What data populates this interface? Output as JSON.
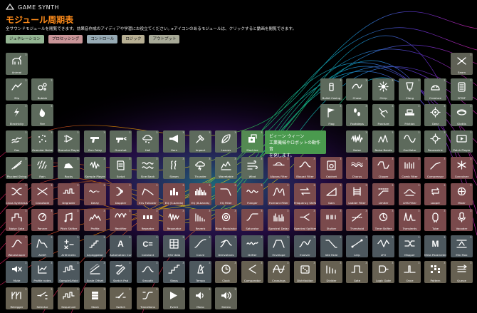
{
  "app": {
    "logo_text": "GAME SYNTH",
    "title": "モジュール周期表",
    "description": "全サウンドモジュールを閲覧できます。効果音作成のアイディアや学習にお役立てください。▸アイコンのあるモジュールは、クリックすると動画を閲覧できます。"
  },
  "filters": [
    {
      "label": "ジェネレーション",
      "color": "#94b593"
    },
    {
      "label": "プロセッシング",
      "color": "#c99598"
    },
    {
      "label": "コントロール",
      "color": "#97abb5"
    },
    {
      "label": "ロジック",
      "color": "#b8b094"
    },
    {
      "label": "アウトプット",
      "color": "#a8aa98"
    }
  ],
  "tooltip": {
    "line1": "ビィーン ウィーン",
    "line2": "工業機械やロボットの動作音",
    "line3": "を発します。"
  },
  "colors": {
    "generation": "#5d6a5c",
    "processing": "#7a4a4c",
    "control": "#4d585e",
    "logic": "#676152",
    "output": "#5f6155",
    "selected": "#548a52"
  },
  "modules": [
    {
      "label": "Animal",
      "cat": "gen",
      "icon": "animal"
    },
    {
      "label": "Seam",
      "cat": "out",
      "icon": "seam"
    },
    {
      "label": "Slip",
      "cat": "gen",
      "icon": "slip"
    },
    {
      "label": "Bubble",
      "cat": "gen",
      "icon": "bubble"
    },
    {
      "label": "Bullet Casing",
      "cat": "gen",
      "icon": "bullet"
    },
    {
      "label": "Chase",
      "cat": "gen",
      "icon": "chase"
    },
    {
      "label": "Chirp",
      "cat": "gen",
      "icon": "chirp"
    },
    {
      "label": "Clang",
      "cat": "gen",
      "icon": "clang"
    },
    {
      "label": "Creature",
      "cat": "gen",
      "icon": "creature"
    },
    {
      "label": "DTMF",
      "cat": "gen",
      "icon": "dtmf"
    },
    {
      "label": "Electricity",
      "cat": "gen",
      "icon": "electricity"
    },
    {
      "label": "Fire",
      "cat": "gen",
      "icon": "fire"
    },
    {
      "label": "Flag",
      "cat": "gen",
      "icon": "flag"
    },
    {
      "label": "Footsteps",
      "cat": "gen",
      "icon": "footsteps"
    },
    {
      "label": "Fracture",
      "cat": "gen",
      "icon": "fracture"
    },
    {
      "label": "Friction",
      "cat": "gen",
      "icon": "friction"
    },
    {
      "label": "Gear",
      "cat": "gen",
      "icon": "gear"
    },
    {
      "label": "Glottis",
      "cat": "gen",
      "icon": "glottis"
    },
    {
      "label": "Gas",
      "cat": "gen",
      "icon": "gas"
    },
    {
      "label": "Granular Noise",
      "cat": "gen",
      "icon": "granular"
    },
    {
      "label": "Granular Player",
      "cat": "gen",
      "icon": "gplayer"
    },
    {
      "label": "Gun Foley",
      "cat": "gen",
      "icon": "gunfoley"
    },
    {
      "label": "Gunshot",
      "cat": "gen",
      "icon": "gunshot"
    },
    {
      "label": "Hail",
      "cat": "gen",
      "icon": "hail"
    },
    {
      "label": "Horn",
      "cat": "gen",
      "icon": "horn"
    },
    {
      "label": "Impact",
      "cat": "gen",
      "icon": "impact"
    },
    {
      "label": "Leaves",
      "cat": "gen",
      "icon": "leaves"
    },
    {
      "label": "Machine",
      "cat": "sel",
      "icon": "machine"
    },
    {
      "label": "Noise",
      "cat": "gen",
      "icon": "noise"
    },
    {
      "label": "Noise Bands",
      "cat": "gen",
      "icon": "noisebands"
    },
    {
      "label": "Oscillator",
      "cat": "gen",
      "icon": "osc"
    },
    {
      "label": "Parametric",
      "cat": "gen",
      "icon": "parametric"
    },
    {
      "label": "Patch Player",
      "cat": "gen",
      "icon": "patchplayer"
    },
    {
      "label": "Plucked String",
      "cat": "gen",
      "icon": "plucked"
    },
    {
      "label": "Rain",
      "cat": "gen",
      "icon": "rain"
    },
    {
      "label": "Rocks",
      "cat": "gen",
      "icon": "rocks"
    },
    {
      "label": "Sample Player",
      "cat": "gen",
      "icon": "sampleplayer"
    },
    {
      "label": "Script",
      "cat": "gen",
      "icon": "script"
    },
    {
      "label": "Sine Bank",
      "cat": "gen",
      "icon": "sinebank"
    },
    {
      "label": "Steam",
      "cat": "gen",
      "icon": "steam"
    },
    {
      "label": "Thunder",
      "cat": "gen",
      "icon": "thunder"
    },
    {
      "label": "Wavetable",
      "cat": "gen",
      "icon": "wavetable"
    },
    {
      "label": "Wind",
      "cat": "gen",
      "icon": "wind"
    },
    {
      "label": "Allpass Filter",
      "cat": "proc",
      "icon": "allpass"
    },
    {
      "label": "Biquad Filter",
      "cat": "proc",
      "icon": "biquad"
    },
    {
      "label": "Cabinet",
      "cat": "proc",
      "icon": "cabinet"
    },
    {
      "label": "Chorus",
      "cat": "proc",
      "icon": "chorus"
    },
    {
      "label": "Clipper",
      "cat": "proc",
      "icon": "clipper"
    },
    {
      "label": "Comb Filter",
      "cat": "proc",
      "icon": "comb"
    },
    {
      "label": "Compressor",
      "cat": "proc",
      "icon": "compressor"
    },
    {
      "label": "Convolver",
      "cat": "proc",
      "icon": "convolver"
    },
    {
      "label": "Cross Synthesis",
      "cat": "proc",
      "icon": "cross"
    },
    {
      "label": "Crossfade",
      "cat": "proc",
      "icon": "crossfade"
    },
    {
      "label": "Degrader",
      "cat": "proc",
      "icon": "degrader"
    },
    {
      "label": "Delay",
      "cat": "proc",
      "icon": "delay"
    },
    {
      "label": "Doppler",
      "cat": "proc",
      "icon": "doppler"
    },
    {
      "label": "Env Follower",
      "cat": "proc",
      "icon": "envfollow"
    },
    {
      "label": "EQ (3-bands)",
      "cat": "proc",
      "icon": "eq3"
    },
    {
      "label": "EQ (8-bands)",
      "cat": "proc",
      "icon": "eq8"
    },
    {
      "label": "EQ Filter",
      "cat": "proc",
      "icon": "eqfilter"
    },
    {
      "label": "Flanger",
      "cat": "proc",
      "icon": "flanger"
    },
    {
      "label": "Formant Filter",
      "cat": "proc",
      "icon": "formant"
    },
    {
      "label": "Frequency Shifter",
      "cat": "proc",
      "icon": "freqshift"
    },
    {
      "label": "Gain",
      "cat": "proc",
      "icon": "gain"
    },
    {
      "label": "Ladder Filter",
      "cat": "proc",
      "icon": "ladder"
    },
    {
      "label": "Limiter",
      "cat": "proc",
      "icon": "limiter"
    },
    {
      "label": "LMS Filter",
      "cat": "proc",
      "icon": "lms"
    },
    {
      "label": "Looper",
      "cat": "proc",
      "icon": "looper"
    },
    {
      "label": "Mixer",
      "cat": "proc",
      "icon": "mixer"
    },
    {
      "label": "Noise Gate",
      "cat": "proc",
      "icon": "noisegate"
    },
    {
      "label": "Panner",
      "cat": "proc",
      "icon": "panner"
    },
    {
      "label": "Pitch Shifter",
      "cat": "proc",
      "icon": "pitch"
    },
    {
      "label": "Profile",
      "cat": "proc",
      "icon": "profile"
    },
    {
      "label": "Rectifier",
      "cat": "proc",
      "icon": "rectifier"
    },
    {
      "label": "Repeater",
      "cat": "proc",
      "icon": "repeater"
    },
    {
      "label": "Resonator",
      "cat": "proc",
      "icon": "resonator"
    },
    {
      "label": "Reverb",
      "cat": "proc",
      "icon": "reverb"
    },
    {
      "label": "Ring Modulator",
      "cat": "proc",
      "icon": "ring"
    },
    {
      "label": "Saturator",
      "cat": "proc",
      "icon": "saturator"
    },
    {
      "label": "Spectral Delay",
      "cat": "proc",
      "icon": "specdelay"
    },
    {
      "label": "Spectral Splitter",
      "cat": "proc",
      "icon": "specsplit"
    },
    {
      "label": "Stutter",
      "cat": "proc",
      "icon": "stutter"
    },
    {
      "label": "Threshold",
      "cat": "proc",
      "icon": "threshold"
    },
    {
      "label": "Time Shifter",
      "cat": "proc",
      "icon": "timeshift"
    },
    {
      "label": "Transients",
      "cat": "proc",
      "icon": "transients"
    },
    {
      "label": "Tube",
      "cat": "proc",
      "icon": "tube"
    },
    {
      "label": "Vocoder",
      "cat": "proc",
      "icon": "vocoder"
    },
    {
      "label": "Waveshaper",
      "cat": "proc",
      "icon": "waveshaper"
    },
    {
      "label": "ADSR",
      "cat": "ctrl",
      "icon": "adsr"
    },
    {
      "label": "Arithmetic",
      "cat": "ctrl",
      "icon": "arith"
    },
    {
      "label": "Arpeggiator",
      "cat": "ctrl",
      "icon": "arp"
    },
    {
      "label": "Automation Curve",
      "cat": "ctrl",
      "icon": "autocurve"
    },
    {
      "label": "Constant",
      "cat": "ctrl",
      "icon": "constant"
    },
    {
      "label": "CSV data",
      "cat": "ctrl",
      "icon": "csv"
    },
    {
      "label": "Curve",
      "cat": "ctrl",
      "icon": "curve"
    },
    {
      "label": "Derivatives",
      "cat": "ctrl",
      "icon": "deriv"
    },
    {
      "label": "Drifter",
      "cat": "ctrl",
      "icon": "drifter"
    },
    {
      "label": "Envelope",
      "cat": "ctrl",
      "icon": "envelope"
    },
    {
      "label": "Evolver",
      "cat": "ctrl",
      "icon": "evolver"
    },
    {
      "label": "Idle Fade",
      "cat": "ctrl",
      "icon": "idlefade"
    },
    {
      "label": "Lerp",
      "cat": "ctrl",
      "icon": "lerp"
    },
    {
      "label": "LFO",
      "cat": "ctrl",
      "icon": "lfo"
    },
    {
      "label": "Mapper",
      "cat": "ctrl",
      "icon": "mapper"
    },
    {
      "label": "Meta Parameter",
      "cat": "ctrl",
      "icon": "meta"
    },
    {
      "label": "Min Max",
      "cat": "ctrl",
      "icon": "minmax"
    },
    {
      "label": "Mute",
      "cat": "ctrl",
      "icon": "mute"
    },
    {
      "label": "Profile notes",
      "cat": "ctrl",
      "icon": "pnotes"
    },
    {
      "label": "Sample&Hold",
      "cat": "ctrl",
      "icon": "snh"
    },
    {
      "label": "Scale Offset",
      "cat": "ctrl",
      "icon": "scaleoff"
    },
    {
      "label": "Sketch Pad",
      "cat": "ctrl",
      "icon": "sketch"
    },
    {
      "label": "Smooth",
      "cat": "ctrl",
      "icon": "smooth"
    },
    {
      "label": "Steps",
      "cat": "ctrl",
      "icon": "steps"
    },
    {
      "label": "Tempo",
      "cat": "ctrl",
      "icon": "tempo"
    },
    {
      "label": "Clock",
      "cat": "logic",
      "icon": "clock"
    },
    {
      "label": "Comparator",
      "cat": "logic",
      "icon": "comparator"
    },
    {
      "label": "Crossings",
      "cat": "logic",
      "icon": "crossings"
    },
    {
      "label": "Distribution",
      "cat": "logic",
      "icon": "distribution"
    },
    {
      "label": "Divider",
      "cat": "logic",
      "icon": "divider"
    },
    {
      "label": "Gate",
      "cat": "logic",
      "icon": "gate"
    },
    {
      "label": "Logic Gate",
      "cat": "logic",
      "icon": "logicgate"
    },
    {
      "label": "Once",
      "cat": "logic",
      "icon": "once"
    },
    {
      "label": "Pattern",
      "cat": "logic",
      "icon": "pattern"
    },
    {
      "label": "Queue",
      "cat": "logic",
      "icon": "queue"
    },
    {
      "label": "Retrigger",
      "cat": "logic",
      "icon": "retrigger"
    },
    {
      "label": "Selector",
      "cat": "logic",
      "icon": "selector"
    },
    {
      "label": "Sequencer",
      "cat": "logic",
      "icon": "sequencer"
    },
    {
      "label": "Stack",
      "cat": "logic",
      "icon": "stack"
    },
    {
      "label": "Switch",
      "cat": "logic",
      "icon": "switch"
    },
    {
      "label": "Transitions",
      "cat": "logic",
      "icon": "transitions"
    },
    {
      "label": "Event",
      "cat": "out",
      "icon": "event"
    },
    {
      "label": "Mono",
      "cat": "out",
      "icon": "mono"
    },
    {
      "label": "Stereo",
      "cat": "out",
      "icon": "stereo"
    }
  ]
}
